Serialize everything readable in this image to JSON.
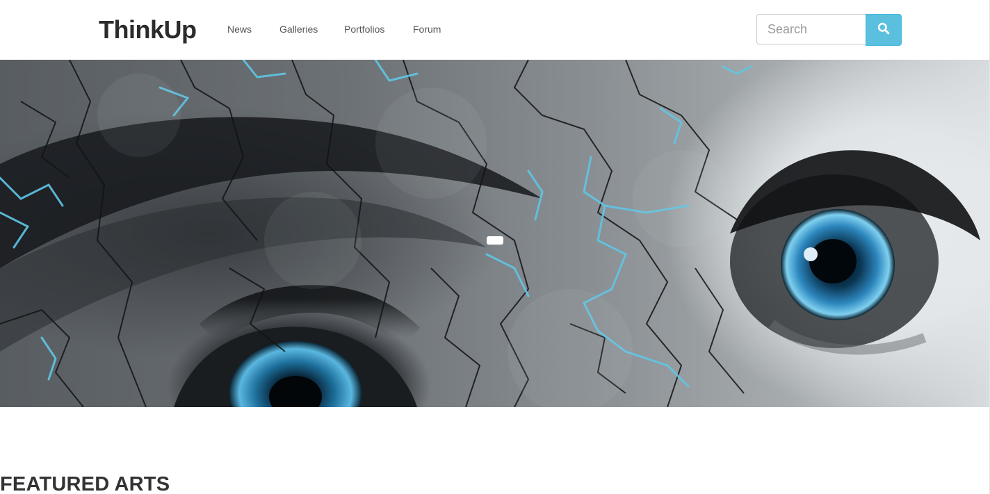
{
  "header": {
    "logo": "ThinkUp",
    "nav": [
      {
        "label": "News"
      },
      {
        "label": "Galleries"
      },
      {
        "label": "Portfolios"
      },
      {
        "label": "Forum"
      }
    ],
    "search": {
      "placeholder": "Search",
      "value": "",
      "button_icon": "search-icon"
    }
  },
  "hero": {
    "image": "cracked-face-blue-eyes-artwork",
    "slider_indicator_count": 1,
    "accent_color": "#5bc0de"
  },
  "featured": {
    "title": "FEATURED ARTS"
  },
  "colors": {
    "brand_text": "#2b2b2b",
    "nav_text": "#555555",
    "search_button": "#5bc0de"
  }
}
